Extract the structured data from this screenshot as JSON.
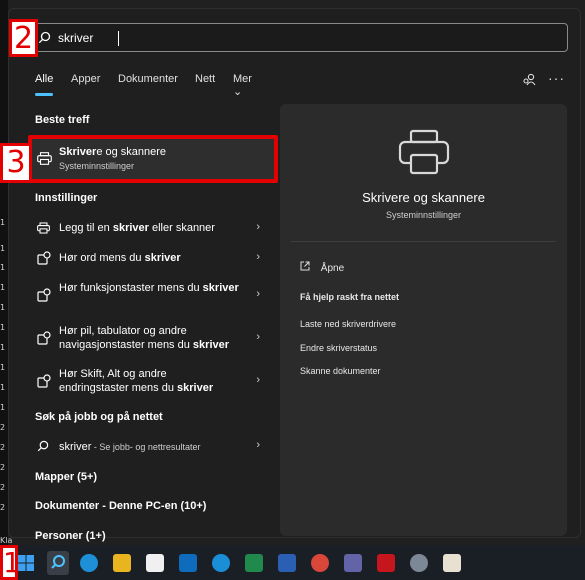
{
  "search": {
    "value": "skriver"
  },
  "tabs": [
    {
      "label": "Alle"
    },
    {
      "label": "Apper"
    },
    {
      "label": "Dokumenter"
    },
    {
      "label": "Nett"
    },
    {
      "label": "Mer ⌄"
    }
  ],
  "sections": {
    "best_match": "Beste treff",
    "settings": "Innstillinger",
    "web": "Søk på jobb og på nettet",
    "folders": "Mapper (5+)",
    "documents": "Dokumenter - Denne PC-en (10+)",
    "people": "Personer (1+)"
  },
  "best_match": {
    "title_bold": "Skriver",
    "title_rest": "e og skannere",
    "subtitle": "Systeminnstillinger"
  },
  "settings_items": [
    {
      "pre": "Legg til en ",
      "bold": "skriver",
      "post": " eller skanner"
    },
    {
      "pre": "Hør ord mens du ",
      "bold": "skriver",
      "post": ""
    },
    {
      "pre": "Hør funksjonstaster mens du ",
      "bold": "skriver",
      "post": ""
    },
    {
      "pre": "Hør pil, tabulator og andre navigasjonstaster mens du ",
      "bold": "skriver",
      "post": ""
    },
    {
      "pre": "Hør Skift, Alt og andre endringstaster mens du ",
      "bold": "skriver",
      "post": ""
    }
  ],
  "web_item": {
    "bold": "skriver",
    "rest": " - Se jobb- og nettresultater"
  },
  "detail": {
    "title": "Skrivere og skannere",
    "subtitle": "Systeminnstillinger",
    "open": "Åpne",
    "help_header": "Få hjelp raskt fra nettet",
    "links": [
      "Laste ned skriverdrivere",
      "Endre skriverstatus",
      "Skanne dokumenter"
    ]
  },
  "annotations": {
    "n1": "1",
    "n2": "2",
    "n3": "3"
  },
  "left_strip": [
    "1",
    "1",
    "1",
    "1",
    "1",
    "1",
    "1",
    "1",
    "1",
    "1",
    "1",
    "1",
    "1",
    "1",
    "1",
    "2",
    "2",
    "2",
    "2",
    "2",
    "2",
    "Kla"
  ],
  "colors": {
    "accent": "#4cc2ff",
    "annotation_red": "#e30000"
  }
}
